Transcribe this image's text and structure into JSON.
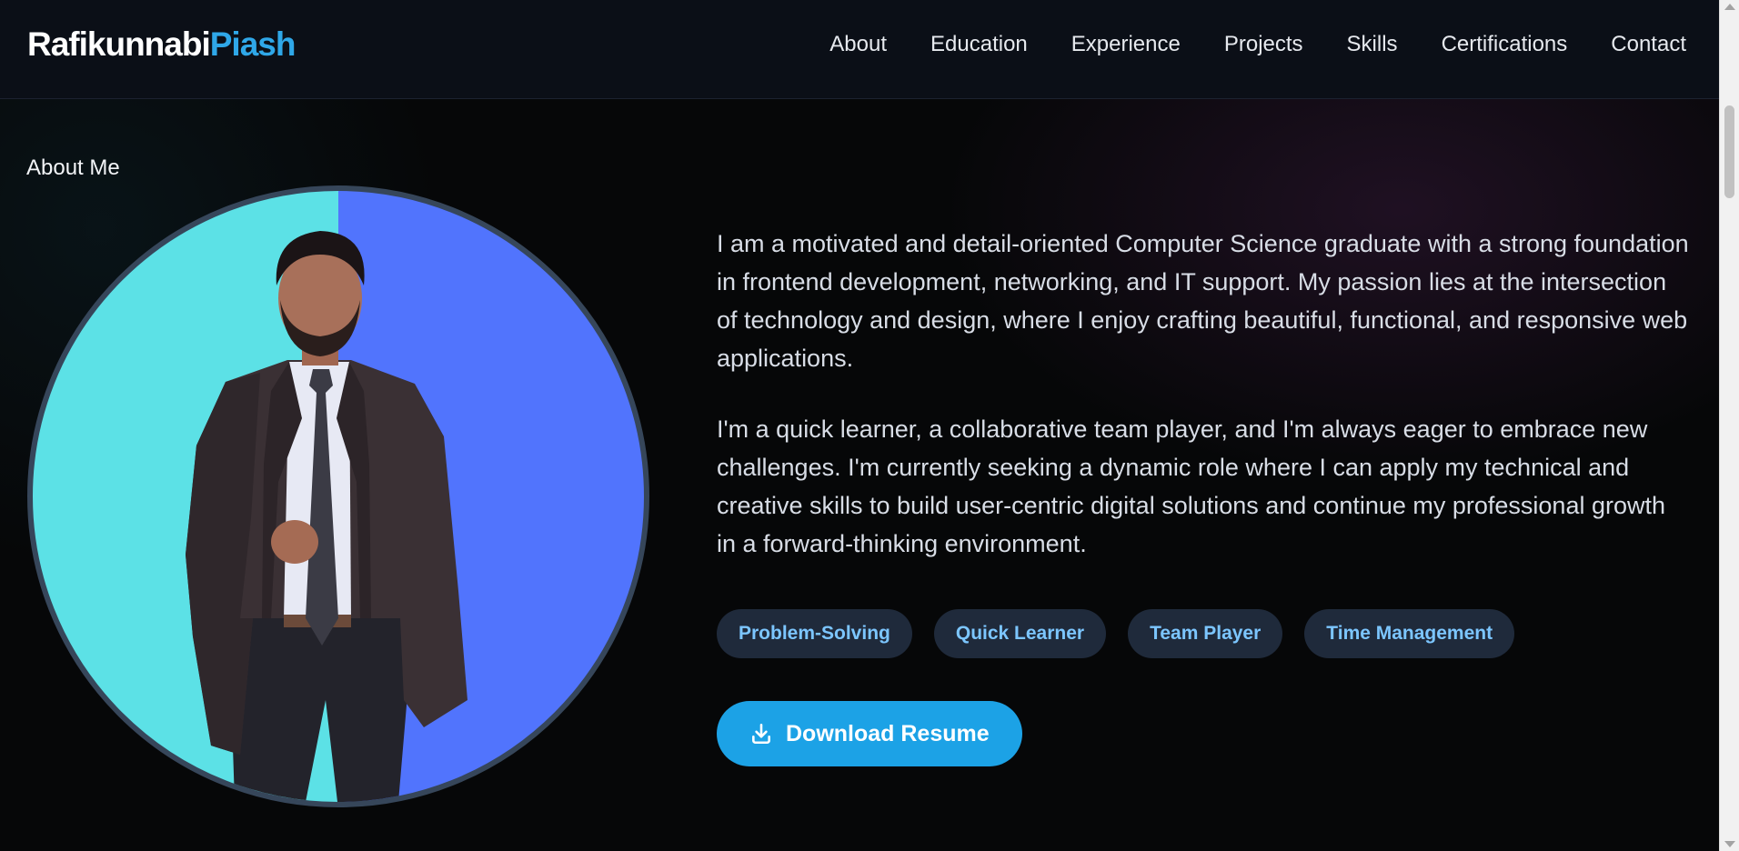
{
  "brand": {
    "first": "Rafikunnabi",
    "last": "Piash"
  },
  "nav": {
    "items": [
      {
        "label": "About"
      },
      {
        "label": "Education"
      },
      {
        "label": "Experience"
      },
      {
        "label": "Projects"
      },
      {
        "label": "Skills"
      },
      {
        "label": "Certifications"
      },
      {
        "label": "Contact"
      }
    ]
  },
  "about": {
    "title": "About Me",
    "paragraphs": [
      "I am a motivated and detail-oriented Computer Science graduate with a strong foundation in frontend development, networking, and IT support. My passion lies at the intersection of technology and design, where I enjoy crafting beautiful, functional, and responsive web applications.",
      "I'm a quick learner, a collaborative team player, and I'm always eager to embrace new challenges. I'm currently seeking a dynamic role where I can apply my technical and creative skills to build user-centric digital solutions and continue my professional growth in a forward-thinking environment."
    ],
    "tags": [
      {
        "label": "Problem-Solving"
      },
      {
        "label": "Quick Learner"
      },
      {
        "label": "Team Player"
      },
      {
        "label": "Time Management"
      }
    ],
    "download_button": {
      "label": "Download Resume",
      "icon": "download-icon"
    },
    "photo": {
      "left_color": "#5ce1e6",
      "right_color": "#5174fd",
      "border_color": "#36465a"
    }
  },
  "colors": {
    "accent": "#2fa7e8",
    "button": "#1ca2e6",
    "tag_bg": "#1f2a3b",
    "tag_text": "#7cc6ff",
    "nav_bg": "#0b0f17",
    "page_bg": "#060708"
  }
}
